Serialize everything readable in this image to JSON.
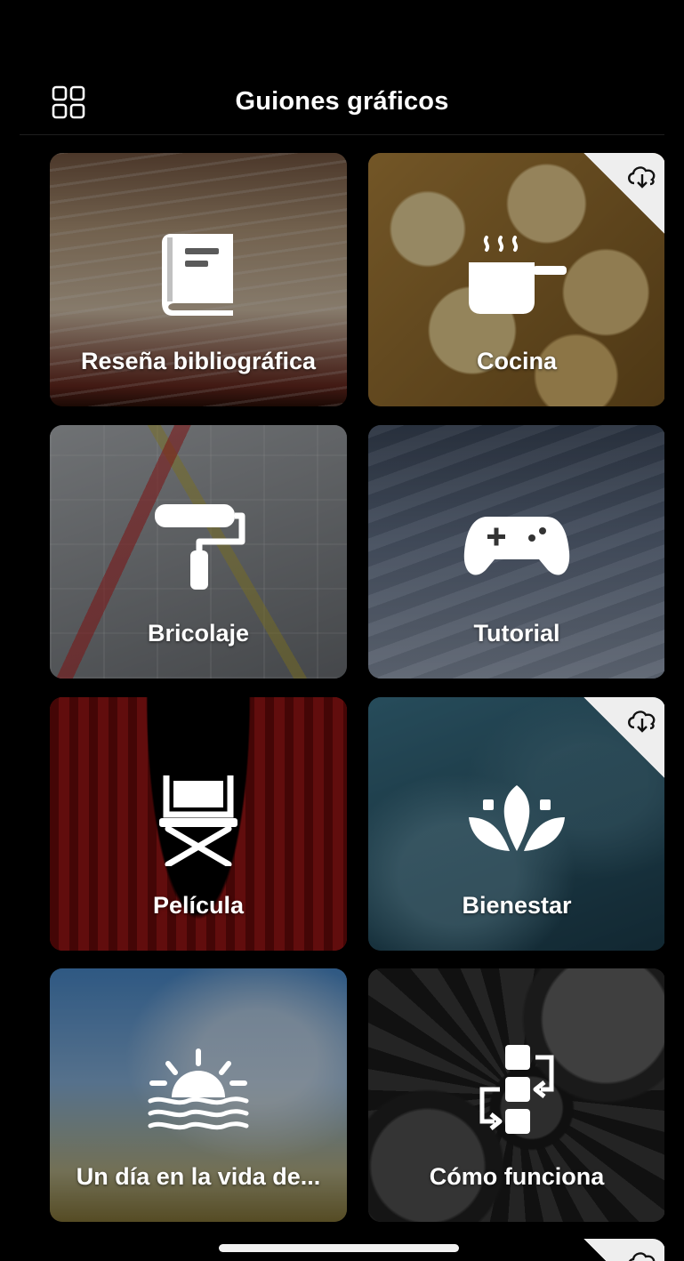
{
  "header": {
    "title": "Guiones gráficos",
    "grid_icon": "grid-layout-icon"
  },
  "tiles": [
    {
      "label": "Reseña bibliográfica",
      "icon": "book-icon",
      "download": false
    },
    {
      "label": "Cocina",
      "icon": "cooking-pot-icon",
      "download": true
    },
    {
      "label": "Bricolaje",
      "icon": "paint-roller-icon",
      "download": false
    },
    {
      "label": "Tutorial",
      "icon": "gamepad-icon",
      "download": false
    },
    {
      "label": "Película",
      "icon": "director-chair-icon",
      "download": false
    },
    {
      "label": "Bienestar",
      "icon": "lotus-icon",
      "download": true
    },
    {
      "label": "Un día en la vida de...",
      "icon": "sunrise-icon",
      "download": false
    },
    {
      "label": "Cómo funciona",
      "icon": "process-flow-icon",
      "download": false
    }
  ],
  "colors": {
    "background": "#000000",
    "text": "#ffffff",
    "download_badge": "#eeeeee"
  }
}
